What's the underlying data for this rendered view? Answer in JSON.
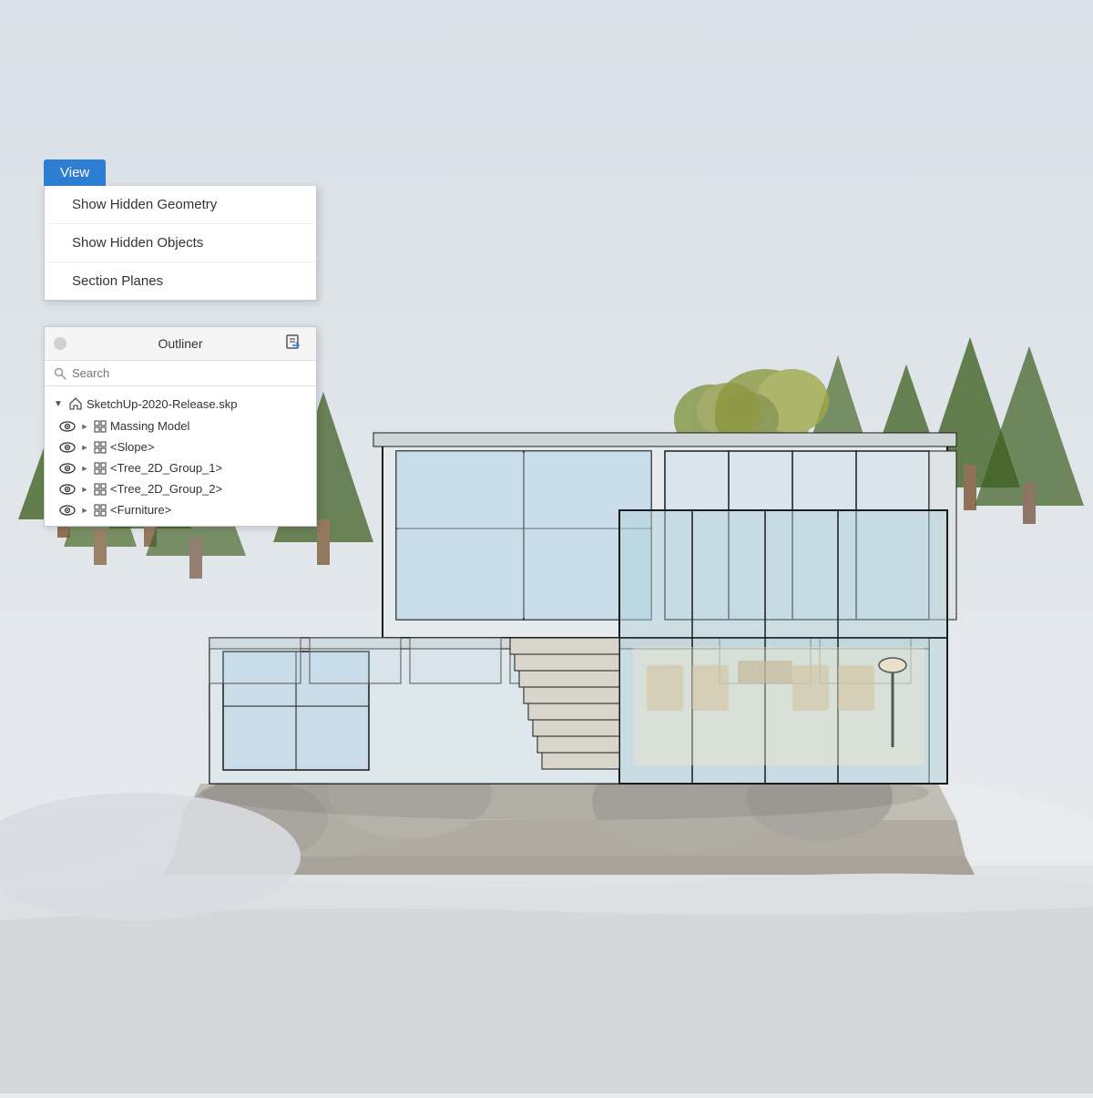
{
  "background": {
    "color_top": "#dce2e8",
    "color_bottom": "#c8c5bc"
  },
  "view_menu": {
    "button_label": "View",
    "items": [
      {
        "id": "show-hidden-geometry",
        "label": "Show Hidden Geometry"
      },
      {
        "id": "show-hidden-objects",
        "label": "Show Hidden Objects"
      },
      {
        "id": "section-planes",
        "label": "Section Planes"
      }
    ]
  },
  "outliner": {
    "title": "Outliner",
    "search_placeholder": "Search",
    "root_file": "SketchUp-2020-Release.skp",
    "tree_items": [
      {
        "id": "massing-model",
        "label": "Massing Model"
      },
      {
        "id": "slope",
        "label": "<Slope>"
      },
      {
        "id": "tree-2d-group-1",
        "label": "<Tree_2D_Group_1>"
      },
      {
        "id": "tree-2d-group-2",
        "label": "<Tree_2D_Group_2>"
      },
      {
        "id": "furniture",
        "label": "<Furniture>"
      }
    ]
  }
}
